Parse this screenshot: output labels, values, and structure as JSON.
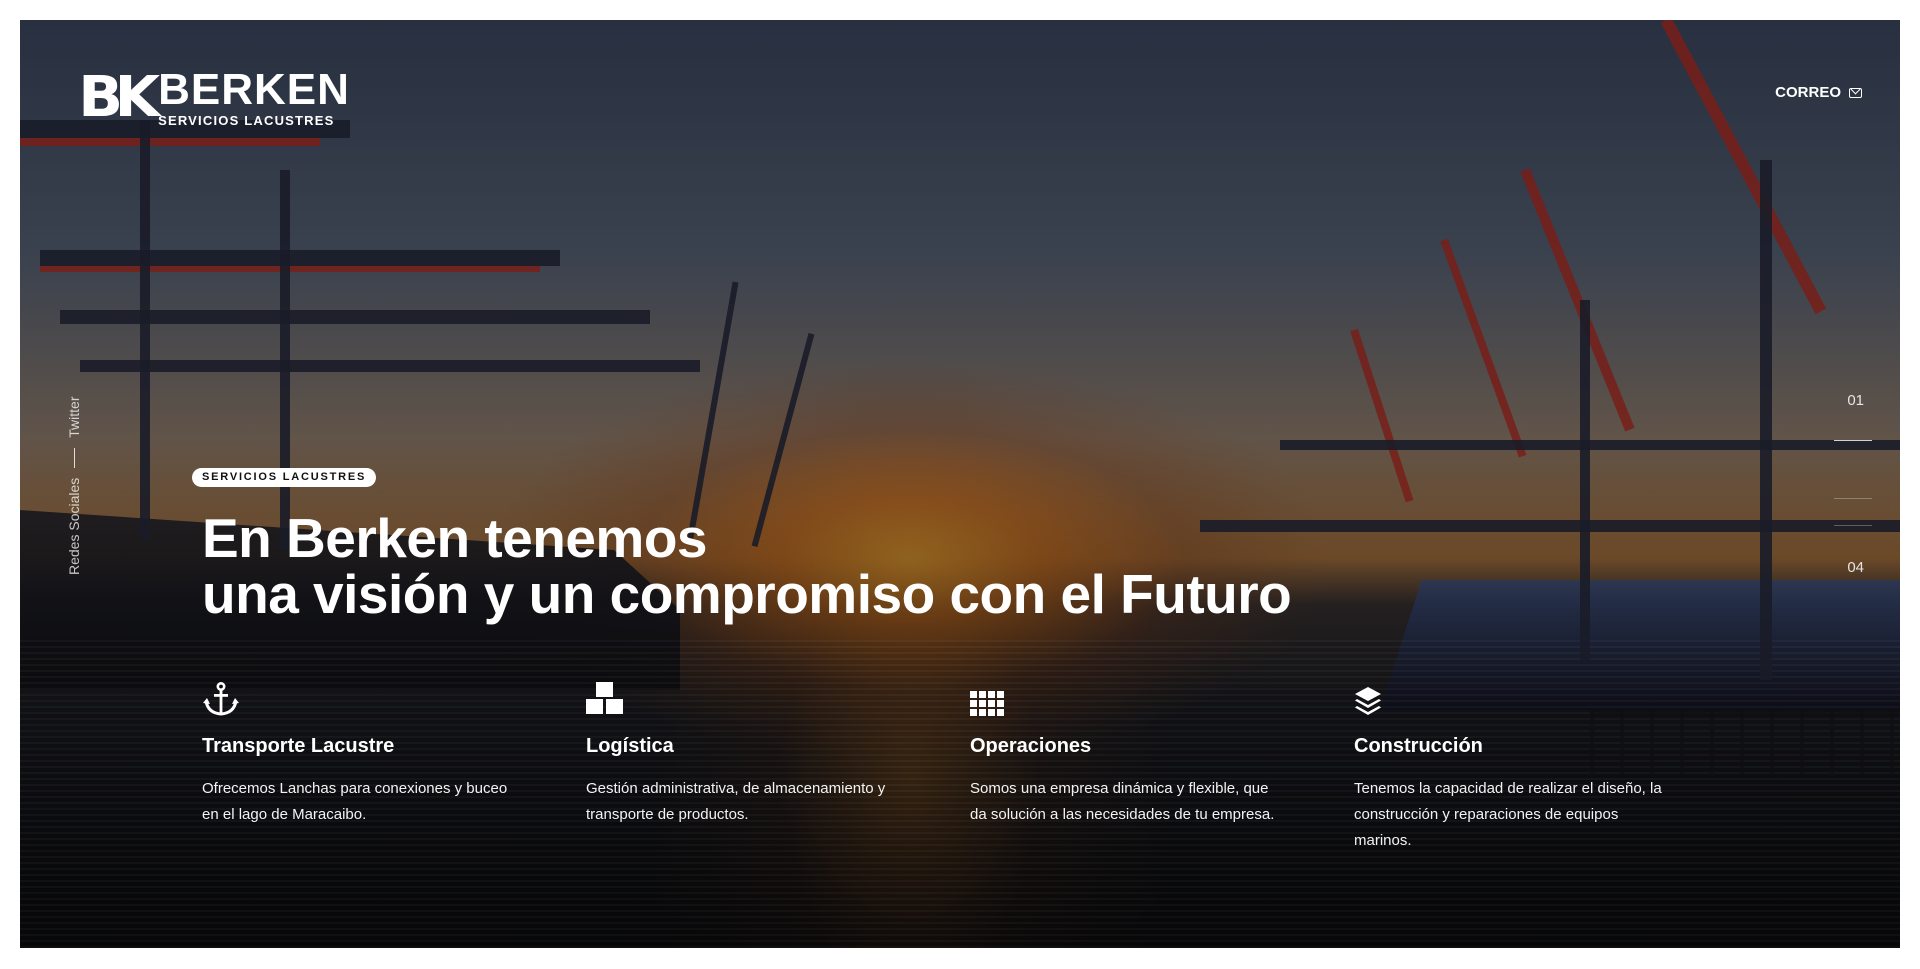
{
  "brand": {
    "mark": "BK",
    "name": "BERKEN",
    "tagline": "SERVICIOS LACUSTRES"
  },
  "header": {
    "mail_label": "CORREO",
    "mail_icon": "envelope-icon"
  },
  "social": {
    "label": "Redes Sociales",
    "link": "Twitter"
  },
  "pager": {
    "current": "01",
    "total": "04"
  },
  "hero": {
    "badge": "SERVICIOS LACUSTRES",
    "line1": "En Berken tenemos",
    "line2": "una visión y un compromiso con el Futuro"
  },
  "features": [
    {
      "icon": "anchor-icon",
      "title": "Transporte Lacustre",
      "desc_line1": "Ofrecemos Lanchas para conexiones y buceo",
      "desc_line2": "en el lago de Maracaibo."
    },
    {
      "icon": "boxes-icon",
      "title": "Logística",
      "desc_line1": "Gestión administrativa, de almacenamiento y",
      "desc_line2": "transporte de productos."
    },
    {
      "icon": "grid-icon",
      "title": "Operaciones",
      "desc_line1": "Somos una empresa dinámica y flexible, que",
      "desc_line2": "da solución a las necesidades de tu empresa."
    },
    {
      "icon": "layers-icon",
      "title": "Construcción",
      "desc_line1": "Tenemos la capacidad de realizar el diseño, la",
      "desc_line2": "construcción y reparaciones de equipos",
      "desc_line3": "marinos."
    }
  ]
}
